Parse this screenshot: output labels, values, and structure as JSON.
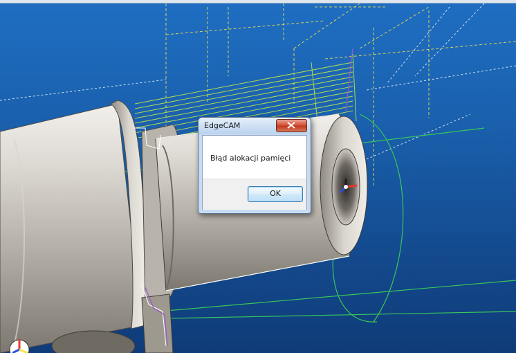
{
  "scene": {
    "background_colors": [
      "#1f6ec2",
      "#0f3b78"
    ],
    "part_colors": [
      "#e3dfd9",
      "#8a857d"
    ],
    "toolpath_color": "#b6e04c",
    "guide_color": "#39c75a",
    "wireframe_color": "#f4e54a"
  },
  "dialog": {
    "title": "EdgeCAM",
    "message": "Błąd alokacji pamięci",
    "ok_label": "OK",
    "close_icon": "close-icon"
  }
}
